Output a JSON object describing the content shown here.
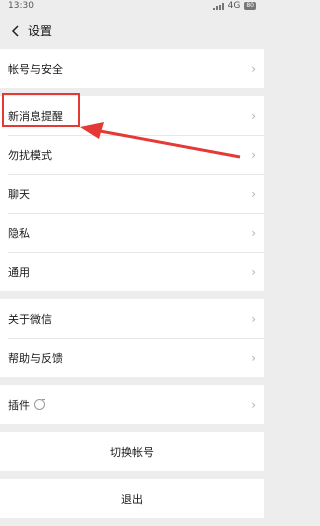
{
  "status_bar": {
    "time": "13:30",
    "network": "4G",
    "battery": "80"
  },
  "header": {
    "title": "设置"
  },
  "groups": [
    {
      "items": [
        {
          "label": "帐号与安全"
        }
      ]
    },
    {
      "items": [
        {
          "label": "新消息提醒"
        },
        {
          "label": "勿扰模式"
        },
        {
          "label": "聊天"
        },
        {
          "label": "隐私"
        },
        {
          "label": "通用"
        }
      ]
    },
    {
      "items": [
        {
          "label": "关于微信"
        },
        {
          "label": "帮助与反馈"
        }
      ]
    },
    {
      "items": [
        {
          "label": "插件"
        }
      ]
    }
  ],
  "actions": {
    "switch_account": "切换帐号",
    "logout": "退出"
  },
  "colors": {
    "annotation": "#e53935",
    "background": "#ededed"
  },
  "icons": {
    "back": "chevron-left-icon",
    "row_arrow": "chevron-right-icon",
    "plugin": "refresh-icon"
  }
}
